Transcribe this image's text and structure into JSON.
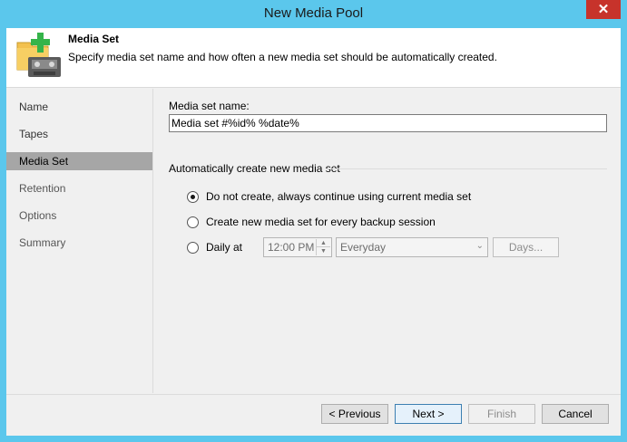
{
  "window": {
    "title": "New Media Pool",
    "close_label": "✕"
  },
  "header": {
    "title": "Media Set",
    "description": "Specify media set name and how often a new media set should be automatically created."
  },
  "sidebar": {
    "items": [
      {
        "label": "Name"
      },
      {
        "label": "Tapes"
      },
      {
        "label": "Media Set"
      },
      {
        "label": "Retention"
      },
      {
        "label": "Options"
      },
      {
        "label": "Summary"
      }
    ]
  },
  "form": {
    "media_set_name_label": "Media set name:",
    "media_set_name_value": "Media set #%id%  %date%",
    "group_label": "Automatically create new media set",
    "options": [
      {
        "label": "Do not create, always continue using current media set",
        "checked": true
      },
      {
        "label": "Create new media set for every backup session",
        "checked": false
      },
      {
        "label": "Daily at",
        "checked": false
      }
    ],
    "time_value": "12:00 PM",
    "schedule_value": "Everyday",
    "days_label": "Days..."
  },
  "footer": {
    "previous_label": "< Previous",
    "next_label": "Next >",
    "finish_label": "Finish",
    "cancel_label": "Cancel"
  },
  "colors": {
    "titlebar": "#5bc7ec",
    "close_button": "#c7332b",
    "active_nav": "#a6a6a6"
  },
  "icons": {
    "header": "media-pool-add-icon",
    "close": "close-icon",
    "spin_up": "chevron-up-icon",
    "spin_down": "chevron-down-icon",
    "dropdown": "chevron-down-icon"
  }
}
